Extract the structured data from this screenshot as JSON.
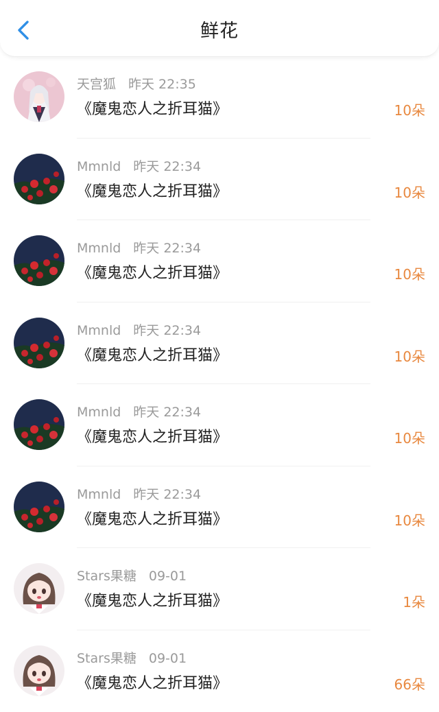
{
  "header": {
    "title": "鲜花",
    "back_icon": "chevron-left-icon",
    "accent_color": "#2f8fe6"
  },
  "amount_color": "#e8883f",
  "items": [
    {
      "user": "天宫狐",
      "time": "昨天 22:35",
      "book": "《魔鬼恋人之折耳猫》",
      "amount": "10朵",
      "avatar": "anime-girl-white-hair-avatar"
    },
    {
      "user": "Mmnld",
      "time": "昨天 22:34",
      "book": "《魔鬼恋人之折耳猫》",
      "amount": "10朵",
      "avatar": "red-flowers-night-avatar"
    },
    {
      "user": "Mmnld",
      "time": "昨天 22:34",
      "book": "《魔鬼恋人之折耳猫》",
      "amount": "10朵",
      "avatar": "red-flowers-night-avatar"
    },
    {
      "user": "Mmnld",
      "time": "昨天 22:34",
      "book": "《魔鬼恋人之折耳猫》",
      "amount": "10朵",
      "avatar": "red-flowers-night-avatar"
    },
    {
      "user": "Mmnld",
      "time": "昨天 22:34",
      "book": "《魔鬼恋人之折耳猫》",
      "amount": "10朵",
      "avatar": "red-flowers-night-avatar"
    },
    {
      "user": "Mmnld",
      "time": "昨天 22:34",
      "book": "《魔鬼恋人之折耳猫》",
      "amount": "10朵",
      "avatar": "red-flowers-night-avatar"
    },
    {
      "user": "Stars果糖",
      "time": "09-01",
      "book": "《魔鬼恋人之折耳猫》",
      "amount": "1朵",
      "avatar": "chibi-girl-avatar"
    },
    {
      "user": "Stars果糖",
      "time": "09-01",
      "book": "《魔鬼恋人之折耳猫》",
      "amount": "66朵",
      "avatar": "chibi-girl-avatar"
    }
  ]
}
